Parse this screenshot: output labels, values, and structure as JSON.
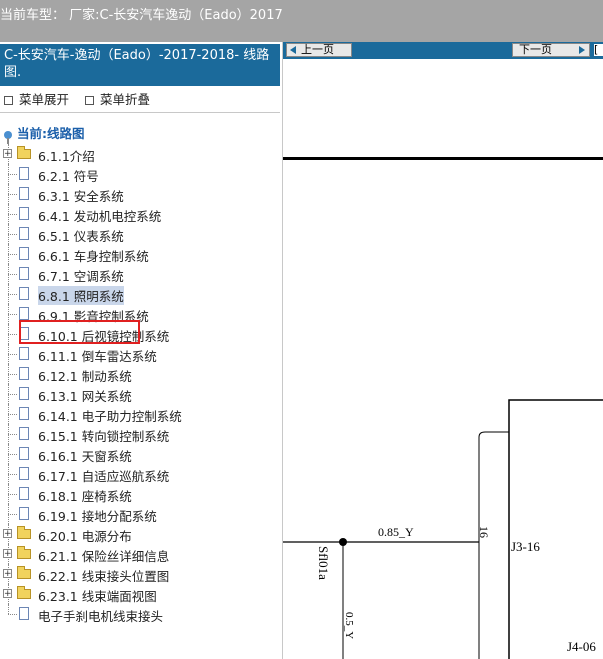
{
  "header": {
    "current_model": "当前车型： 厂家:C-长安汽车逸动（Eado）2017"
  },
  "sidebar": {
    "model_title": "C-长安汽车-逸动（Eado）-2017-2018- 线路图.",
    "expand_label": "菜单展开",
    "collapse_label": "菜单折叠",
    "current_label": "当前:线路图",
    "items": [
      {
        "label": "6.1.1介绍",
        "type": "folder"
      },
      {
        "label": "6.2.1 符号",
        "type": "page"
      },
      {
        "label": "6.3.1 安全系统",
        "type": "page"
      },
      {
        "label": "6.4.1 发动机电控系统",
        "type": "page"
      },
      {
        "label": "6.5.1 仪表系统",
        "type": "page"
      },
      {
        "label": "6.6.1 车身控制系统",
        "type": "page"
      },
      {
        "label": "6.7.1 空调系统",
        "type": "page"
      },
      {
        "label": "6.8.1 照明系统",
        "type": "page",
        "selected": true
      },
      {
        "label": "6.9.1 影音控制系统",
        "type": "page"
      },
      {
        "label": "6.10.1 后视镜控制系统",
        "type": "page"
      },
      {
        "label": "6.11.1 倒车雷达系统",
        "type": "page"
      },
      {
        "label": "6.12.1 制动系统",
        "type": "page"
      },
      {
        "label": "6.13.1 网关系统",
        "type": "page"
      },
      {
        "label": "6.14.1 电子助力控制系统",
        "type": "page"
      },
      {
        "label": "6.15.1 转向锁控制系统",
        "type": "page"
      },
      {
        "label": "6.16.1 天窗系统",
        "type": "page"
      },
      {
        "label": "6.17.1 自适应巡航系统",
        "type": "page"
      },
      {
        "label": "6.18.1 座椅系统",
        "type": "page"
      },
      {
        "label": "6.19.1 接地分配系统",
        "type": "page"
      },
      {
        "label": "6.20.1 电源分布",
        "type": "folder"
      },
      {
        "label": "6.21.1 保险丝详细信息",
        "type": "folder"
      },
      {
        "label": "6.22.1 线束接头位置图",
        "type": "folder"
      },
      {
        "label": "6.23.1 线束端面视图",
        "type": "folder"
      },
      {
        "label": "电子手刹电机线束接头",
        "type": "page"
      }
    ]
  },
  "viewer": {
    "prev_label": "上一页",
    "next_label": "下一页",
    "tail_glyph": "[",
    "diagram": {
      "wire_label": "0.85_Y",
      "wire_label_2": "0.5_Y",
      "splice_label": "Sfl01a",
      "pin_number": "16",
      "connector_1": "J3-16",
      "connector_2": "J4-06"
    }
  },
  "colors": {
    "title_bar": "#1b6a9b",
    "top_bar": "#a5a5a5",
    "highlight_box": "#e02020"
  }
}
